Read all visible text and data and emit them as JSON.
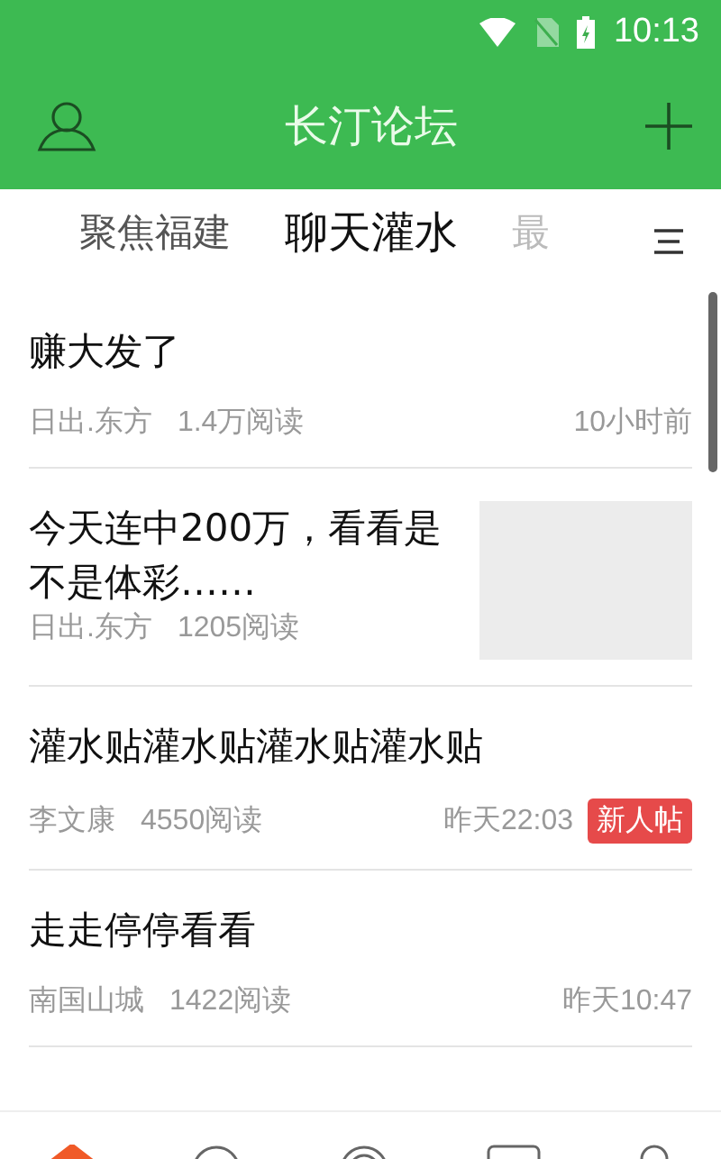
{
  "status_bar": {
    "time": "10:13"
  },
  "header": {
    "title": "长汀论坛"
  },
  "tabs": [
    {
      "label": "聚焦福建",
      "selected": false
    },
    {
      "label": "聊天灌水",
      "selected": true
    },
    {
      "label": "最",
      "selected": false
    }
  ],
  "posts": [
    {
      "title": "赚大发了",
      "author": "日出.东方",
      "reads": "1.4万阅读",
      "time": "10小时前",
      "kind": "text"
    },
    {
      "title": "今天连中200万，看看是不是体彩……",
      "author": "日出.东方",
      "reads": "1205阅读",
      "kind": "thumbnail"
    },
    {
      "title": "灌水贴灌水贴灌水贴灌水贴",
      "author": "李文康",
      "reads": "4550阅读",
      "time": "昨天22:03",
      "badge": "新人帖",
      "kind": "text"
    },
    {
      "title": "走走停停看看",
      "author": "南国山城",
      "reads": "1422阅读",
      "time": "昨天10:47",
      "kind": "text"
    }
  ],
  "bottom_nav": [
    {
      "selected": true
    },
    {
      "selected": false
    },
    {
      "selected": false
    },
    {
      "selected": false
    },
    {
      "selected": false
    }
  ]
}
